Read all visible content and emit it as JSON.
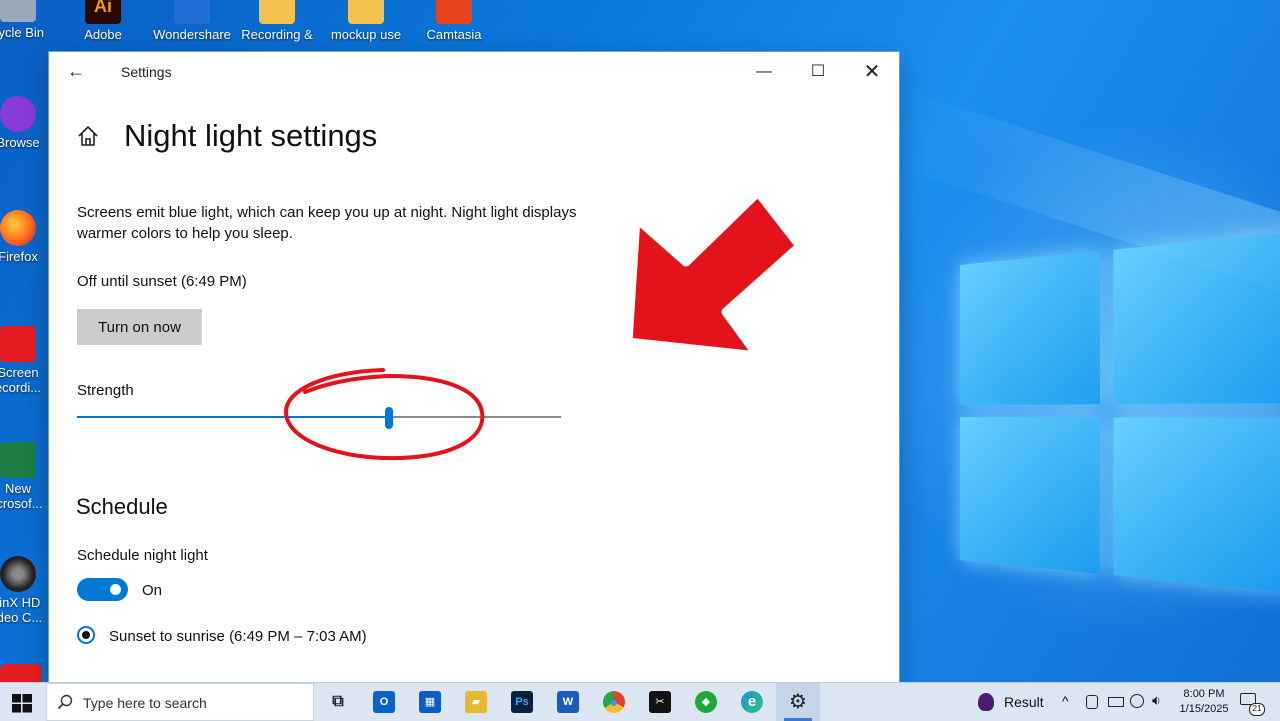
{
  "desktop": {
    "icons": [
      {
        "label": "cycle Bin",
        "color": "#9aa8b8"
      },
      {
        "label": "Browse",
        "color": "#8a3ad8"
      },
      {
        "label": "Firefox",
        "color": "#ff7a1a"
      },
      {
        "label": "Screen",
        "label2": "ecordi...",
        "color": "#e61c23"
      },
      {
        "label": "New",
        "label2": "icrosof...",
        "color": "#1e7d45"
      },
      {
        "label": "/inX HD",
        "label2": "ideo C...",
        "color": "#333333"
      },
      {
        "label": "Adobe",
        "color": "#2a0a00"
      },
      {
        "label": "Wondershare",
        "color": "#1f6fd6"
      },
      {
        "label": "Recording &",
        "color": "#f2c14e"
      },
      {
        "label": "mockup use",
        "color": "#f2c14e"
      },
      {
        "label": "Camtasia",
        "color": "#e8451e"
      }
    ],
    "adobe_badge": "Ai"
  },
  "window": {
    "title": "Settings",
    "back_glyph": "←",
    "minimize_glyph": "—",
    "maximize_glyph": "☐",
    "close_glyph": "✕"
  },
  "page": {
    "title": "Night light settings",
    "description": "Screens emit blue light, which can keep you up at night. Night light displays warmer colors to help you sleep.",
    "status": "Off until sunset (6:49 PM)",
    "turn_on_label": "Turn on now",
    "strength_label": "Strength",
    "strength_value": 0.645,
    "schedule_heading": "Schedule",
    "schedule_label": "Schedule night light",
    "schedule_state": "On",
    "option_label": "Sunset to sunrise (6:49 PM – 7:03 AM)"
  },
  "taskbar": {
    "search_placeholder": "Type here to search",
    "apps": [
      {
        "name": "task-view",
        "glyph": "⧉",
        "color": "#ffffff"
      },
      {
        "name": "outlook",
        "glyph": "O",
        "color": "#0a64c8"
      },
      {
        "name": "store",
        "glyph": "▦",
        "color": "#0a5cc6"
      },
      {
        "name": "file-explorer",
        "glyph": "▰",
        "color": "#e8b830"
      },
      {
        "name": "photoshop",
        "glyph": "Ps",
        "color": "#0d1f3a"
      },
      {
        "name": "word",
        "glyph": "W",
        "color": "#1b5bbd"
      },
      {
        "name": "chrome",
        "glyph": "●",
        "color": "#e34133"
      },
      {
        "name": "capcut",
        "glyph": "✂",
        "color": "#111111"
      },
      {
        "name": "green-app",
        "glyph": "◆",
        "color": "#1fa83a"
      },
      {
        "name": "edge",
        "glyph": "e",
        "color": "#1a8fd8"
      },
      {
        "name": "settings",
        "glyph": "⚙",
        "color": "#dce6f2"
      }
    ],
    "result_label": "Result",
    "time": "8:00 PM",
    "date": "1/15/2025",
    "notification_count": "21"
  },
  "colors": {
    "accent": "#0078d7",
    "annotation_red": "#e4131b"
  }
}
